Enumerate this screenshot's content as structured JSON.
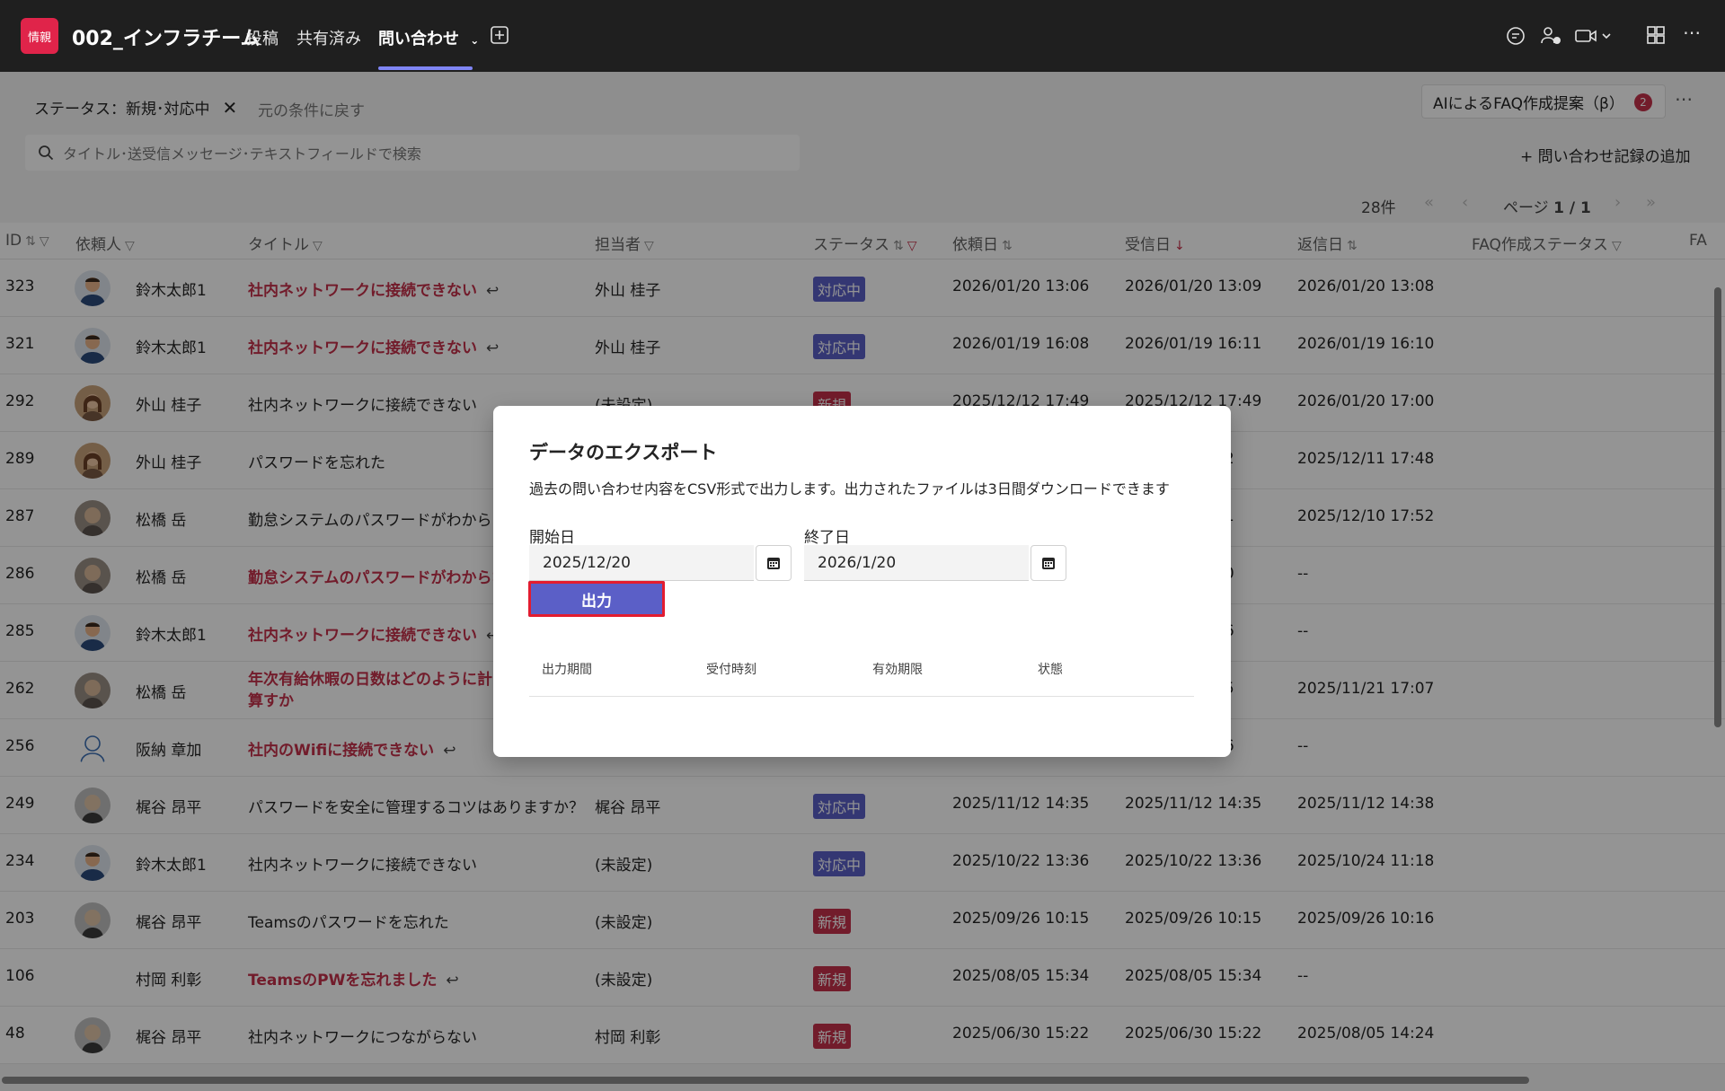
{
  "app": {
    "team_icon_text": "情親",
    "team_name": "002_インフラチーム",
    "tabs": [
      {
        "label": "投稿"
      },
      {
        "label": "共有済み"
      },
      {
        "label": "問い合わせ"
      }
    ],
    "accent_color": "#5b5fc7"
  },
  "toolbar": {
    "filter_chip": "ステータス：新規･対応中",
    "reset_link": "元の条件に戻す",
    "ai_button": "AIによるFAQ作成提案（β）",
    "ai_badge": "2",
    "search_placeholder": "タイトル･送受信メッセージ･テキストフィールドで検索",
    "add_record": "+ 問い合わせ記録の追加",
    "count": "28件",
    "page_label": "ページ",
    "page_value": "1 / 1"
  },
  "table": {
    "headers": [
      "ID",
      "依頼人",
      "タイトル",
      "担当者",
      "ステータス",
      "依頼日",
      "受信日",
      "返信日",
      "FAQ作成ステータス",
      "FA"
    ],
    "rows": [
      {
        "id": "323",
        "requester": "鈴木太郎1",
        "title": "社内ネットワークに接続できない",
        "title_link": true,
        "reply": true,
        "assignee": "外山 桂子",
        "status": "対応中",
        "requested": "2026/01/20 13:06",
        "received": "2026/01/20 13:09",
        "replied": "2026/01/20 13:08",
        "avatar": "male"
      },
      {
        "id": "321",
        "requester": "鈴木太郎1",
        "title": "社内ネットワークに接続できない",
        "title_link": true,
        "reply": true,
        "assignee": "外山 桂子",
        "status": "対応中",
        "requested": "2026/01/19 16:08",
        "received": "2026/01/19 16:11",
        "replied": "2026/01/19 16:10",
        "avatar": "male"
      },
      {
        "id": "292",
        "requester": "外山 桂子",
        "title": "社内ネットワークに接続できない",
        "title_link": false,
        "reply": false,
        "assignee": "(未設定)",
        "status": "新規",
        "requested": "2025/12/12 17:49",
        "received": "2025/12/12 17:49",
        "replied": "2026/01/20 17:00",
        "avatar": "female"
      },
      {
        "id": "289",
        "requester": "外山 桂子",
        "title": "パスワードを忘れた",
        "title_link": false,
        "reply": false,
        "assignee": "",
        "status": "",
        "requested": "",
        "received": "42",
        "replied": "2025/12/11 17:48",
        "avatar": "female"
      },
      {
        "id": "287",
        "requester": "松橋 岳",
        "title": "勤怠システムのパスワードがわからない",
        "title_link": false,
        "reply": false,
        "assignee": "",
        "status": "",
        "requested": "",
        "received": "51",
        "replied": "2025/12/10 17:52",
        "avatar": "photo"
      },
      {
        "id": "286",
        "requester": "松橋 岳",
        "title": "勤怠システムのパスワードがわからない",
        "title_link": true,
        "reply": false,
        "assignee": "",
        "status": "",
        "requested": "",
        "received": "20",
        "replied": "--",
        "avatar": "photo"
      },
      {
        "id": "285",
        "requester": "鈴木太郎1",
        "title": "社内ネットワークに接続できない",
        "title_link": true,
        "reply": true,
        "assignee": "",
        "status": "",
        "requested": "",
        "received": "26",
        "replied": "--",
        "avatar": "male"
      },
      {
        "id": "262",
        "requester": "松橋 岳",
        "title": "年次有給休暇の日数はどのように計算すか",
        "title_link": true,
        "reply": false,
        "assignee": "",
        "status": "",
        "requested": "",
        "received": "15",
        "replied": "2025/11/21 17:07",
        "avatar": "photo"
      },
      {
        "id": "256",
        "requester": "阪納 章加",
        "title": "社内のWifiに接続できない",
        "title_link": true,
        "reply": true,
        "assignee": "",
        "status": "",
        "requested": "",
        "received": "06",
        "replied": "--",
        "avatar": "outline"
      },
      {
        "id": "249",
        "requester": "梶谷 昂平",
        "title": "パスワードを安全に管理するコツはありますか？",
        "title_link": false,
        "reply": false,
        "assignee": "梶谷 昂平",
        "status": "対応中",
        "requested": "2025/11/12 14:35",
        "received": "2025/11/12 14:35",
        "replied": "2025/11/12 14:38",
        "avatar": "photo2"
      },
      {
        "id": "234",
        "requester": "鈴木太郎1",
        "title": "社内ネットワークに接続できない",
        "title_link": false,
        "reply": false,
        "assignee": "(未設定)",
        "status": "対応中",
        "requested": "2025/10/22 13:36",
        "received": "2025/10/22 13:36",
        "replied": "2025/10/24 11:18",
        "avatar": "male"
      },
      {
        "id": "203",
        "requester": "梶谷 昂平",
        "title": "Teamsのパスワードを忘れた",
        "title_link": false,
        "reply": false,
        "assignee": "(未設定)",
        "status": "新規",
        "requested": "2025/09/26 10:15",
        "received": "2025/09/26 10:15",
        "replied": "2025/09/26 10:16",
        "avatar": "photo2"
      },
      {
        "id": "106",
        "requester": "村岡 利彰",
        "title": "TeamsのPWを忘れました",
        "title_link": true,
        "reply": true,
        "assignee": "(未設定)",
        "status": "新規",
        "requested": "2025/08/05 15:34",
        "received": "2025/08/05 15:34",
        "replied": "--",
        "avatar": "none"
      },
      {
        "id": "48",
        "requester": "梶谷 昂平",
        "title": "社内ネットワークにつながらない",
        "title_link": false,
        "reply": false,
        "assignee": "村岡 利彰",
        "status": "新規",
        "requested": "2025/06/30 15:22",
        "received": "2025/06/30 15:22",
        "replied": "2025/08/05 14:24",
        "avatar": "photo2"
      }
    ]
  },
  "dialog": {
    "title": "データのエクスポート",
    "description": "過去の問い合わせ内容をCSV形式で出力します。出力されたファイルは3日間ダウンロードできます",
    "start_label": "開始日",
    "start_value": "2025/12/20",
    "end_label": "終了日",
    "end_value": "2026/1/20",
    "export_button": "出力",
    "columns": [
      "出力期間",
      "受付時刻",
      "有効期限",
      "状態"
    ]
  }
}
